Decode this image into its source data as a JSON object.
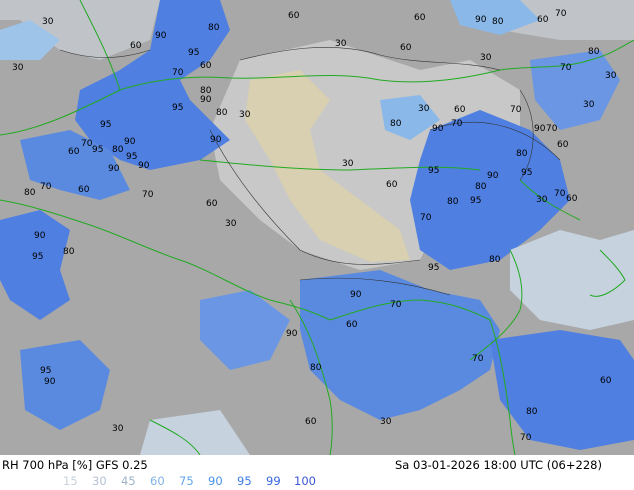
{
  "header": {
    "title": "RH 700 hPa [%] GFS 0.25",
    "valid_time": "Sa 03-01-2026 18:00 UTC (06+228)"
  },
  "legend": {
    "levels": [
      {
        "label": "15",
        "color": "#c8d2dc"
      },
      {
        "label": "30",
        "color": "#b4c2d2"
      },
      {
        "label": "45",
        "color": "#9fb3c9"
      },
      {
        "label": "60",
        "color": "#7fb2e6"
      },
      {
        "label": "75",
        "color": "#64a6e6"
      },
      {
        "label": "90",
        "color": "#4a92e6"
      },
      {
        "label": "95",
        "color": "#3c7ce6"
      },
      {
        "label": "99",
        "color": "#3366dd"
      },
      {
        "label": "100",
        "color": "#3a56d6"
      }
    ]
  },
  "contour_labels": [
    "30",
    "60",
    "90",
    "80",
    "60",
    "90",
    "80",
    "60",
    "70",
    "30",
    "30",
    "95",
    "30",
    "60",
    "60",
    "70",
    "80",
    "60",
    "30",
    "70",
    "90",
    "80",
    "95",
    "70",
    "30",
    "80",
    "90",
    "70",
    "30",
    "90",
    "95",
    "80",
    "95",
    "90",
    "80",
    "60",
    "70",
    "30",
    "60",
    "90",
    "70",
    "95",
    "80",
    "90",
    "60",
    "70",
    "80",
    "90",
    "95",
    "60",
    "80",
    "70",
    "30",
    "60",
    "90",
    "95",
    "70",
    "80",
    "60",
    "30",
    "95",
    "90",
    "80",
    "70",
    "60",
    "30",
    "95",
    "80",
    "90",
    "70",
    "60",
    "95",
    "90",
    "80",
    "70",
    "60",
    "30",
    "90",
    "95",
    "80",
    "70",
    "60",
    "30"
  ]
}
